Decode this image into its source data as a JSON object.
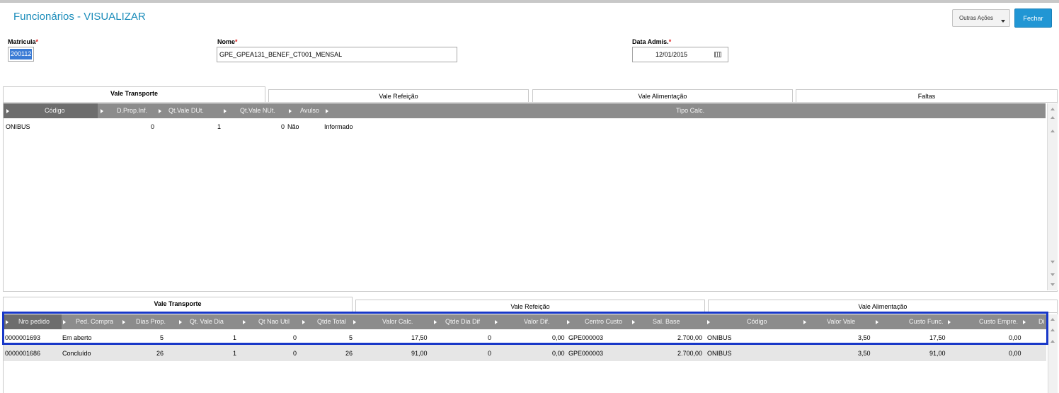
{
  "header": {
    "title": "Funcionários - VISUALIZAR",
    "outras_acoes": "Outras Ações",
    "fechar": "Fechar"
  },
  "form": {
    "matricula_label": "Matricula",
    "matricula_value": "200112",
    "nome_label": "Nome",
    "nome_value": "GPE_GPEA131_BENEF_CT001_MENSAL",
    "data_label": "Data Admis.",
    "data_value": "12/01/2015",
    "required": "*"
  },
  "top_tabs": [
    "Vale Transporte",
    "Vale Refeição",
    "Vale Alimentação",
    "Faltas"
  ],
  "top_grid": {
    "columns": [
      "Código",
      "D.Prop.Inf.",
      "Qt.Vale DUt.",
      "Qt.Vale NUt.",
      "Avulso",
      "Tipo Calc."
    ],
    "rows": [
      [
        "ONIBUS",
        "0",
        "1",
        "0",
        "Não",
        "Informado"
      ]
    ]
  },
  "bottom_tabs": [
    "Vale Transporte",
    "Vale Refeição",
    "Vale Alimentação"
  ],
  "bottom_grid": {
    "columns": [
      "Nro pedido",
      "Ped. Compra",
      "Dias Prop.",
      "Qt. Vale Dia",
      "Qt Nao Util",
      "Qtde Total",
      "Valor Calc.",
      "Qtde Dia Dif",
      "Valor Dif.",
      "Centro Custo",
      "Sal. Base",
      "Código",
      "Valor Vale",
      "Custo Func.",
      "Custo Empre.",
      "Di"
    ],
    "rows": [
      [
        "0000001693",
        "Em aberto",
        "5",
        "1",
        "0",
        "5",
        "17,50",
        "0",
        "0,00",
        "GPE000003",
        "2.700,00",
        "ONIBUS",
        "3,50",
        "17,50",
        "0,00"
      ],
      [
        "0000001686",
        "Concluído",
        "26",
        "1",
        "0",
        "26",
        "91,00",
        "0",
        "0,00",
        "GPE000003",
        "2.700,00",
        "ONIBUS",
        "3,50",
        "91,00",
        "0,00"
      ]
    ]
  },
  "colors": {
    "title": "#1a8cba",
    "primary_button": "#2196d4",
    "header_grey": "#8c8c8c",
    "highlight": "#1838c8",
    "required": "#e01e1e"
  }
}
